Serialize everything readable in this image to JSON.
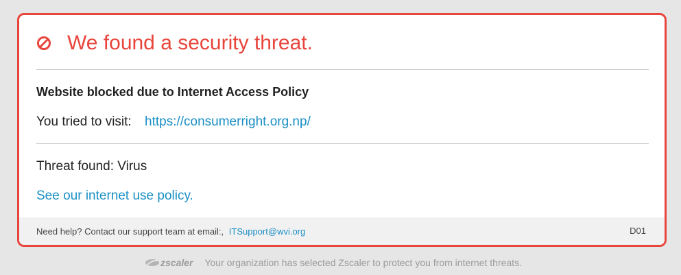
{
  "alert": {
    "title": "We found a security threat.",
    "icon": "block-icon",
    "accent_color": "#e8453c",
    "heading": "Website blocked due to Internet Access Policy",
    "visit_label": "You tried to visit:",
    "visit_url": "https://consumerright.org.np/",
    "threat_text": "Threat found: Virus",
    "policy_link": "See our internet use policy.",
    "link_color": "#1a8fc4"
  },
  "footer": {
    "help_text": "Need help? Contact our support team at email:,",
    "email": "ITSupport@wvi.org",
    "code": "D01"
  },
  "bottom": {
    "logo_text": "zscaler",
    "message": "Your organization has selected Zscaler to protect you from internet threats."
  }
}
